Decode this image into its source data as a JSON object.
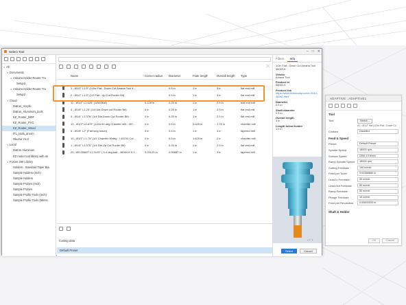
{
  "dialog": {
    "title": "Select Tool",
    "tabs": [
      "Filters",
      "Info"
    ],
    "buttons": {
      "select": "Select",
      "cancel": "Cancel"
    },
    "window_controls": [
      "–",
      "□",
      "✕"
    ]
  },
  "library_tree": [
    {
      "label": "All",
      "level": 0,
      "caret": "∨"
    },
    {
      "label": "Documents",
      "level": 1,
      "caret": "∨"
    },
    {
      "label": "Arduino Holder Router Tra",
      "level": 2,
      "caret": "∨"
    },
    {
      "label": "Setup3",
      "level": 3,
      "caret": ""
    },
    {
      "label": "Arduino Holder Router Tra",
      "level": 2,
      "caret": "∨"
    },
    {
      "label": "Setup2",
      "level": 3,
      "caret": ""
    },
    {
      "label": "Cloud",
      "level": 1,
      "caret": "∨"
    },
    {
      "label": "Datron_Acrylic",
      "level": 2,
      "caret": ""
    },
    {
      "label": "Datron_Aluminum_tools",
      "level": 2,
      "caret": ""
    },
    {
      "label": "EZ_Router_MDF",
      "level": 2,
      "caret": ""
    },
    {
      "label": "EZ_Router_PVC",
      "level": 2,
      "caret": ""
    },
    {
      "label": "EZ_Router_Wood",
      "level": 2,
      "caret": "",
      "selected": true
    },
    {
      "label": "IFL_tools_aroom",
      "level": 2,
      "caret": ""
    },
    {
      "label": "Okuma V1.3",
      "level": 2,
      "caret": ""
    },
    {
      "label": "Local",
      "level": 1,
      "caret": "∨"
    },
    {
      "label": "Datron Aluminum",
      "level": 2,
      "caret": ""
    },
    {
      "label": "EZ router tool library with an",
      "level": 2,
      "caret": ""
    },
    {
      "label": "Fusion 360 Library",
      "level": 1,
      "caret": "∨"
    },
    {
      "label": "Holders - Standard Taper Bla",
      "level": 2,
      "caret": ""
    },
    {
      "label": "Sample Holders (Inch)",
      "level": 2,
      "caret": ""
    },
    {
      "label": "Sample Holders",
      "level": 2,
      "caret": ""
    },
    {
      "label": "Sample Probes (Inch)",
      "level": 2,
      "caret": ""
    },
    {
      "label": "Sample Probes",
      "level": 2,
      "caret": ""
    },
    {
      "label": "Sample Profile Tools (Inch)",
      "level": 2,
      "caret": ""
    },
    {
      "label": "Sample Profile Tools (Metric",
      "level": 2,
      "caret": ""
    }
  ],
  "table": {
    "headers": [
      "Name",
      "Corner radius",
      "Diameter",
      "Flute length",
      "Overall length",
      "Type"
    ],
    "rows": [
      {
        "name": "1 - Ø1/2\" L1.5\" (1/2in Flat - Down Cut Amana Tool 4...",
        "corner": "",
        "diameter": "0.5 in",
        "flute": "1 in",
        "overall": "3 in",
        "type": "flat end mill",
        "selected": true
      },
      {
        "name": "2 - Ø1/2\" L1.5\" (1/2 Flat - Up Cut Router Bit)",
        "corner": "",
        "diameter": "0.5 in",
        "flute": "1 in",
        "overall": "3 in",
        "type": "flat end mill"
      },
      {
        "name": "11 - Ø1/4\" L1.625\" (1/8in Ball)",
        "corner": "0.125 in",
        "diameter": "0.25 in",
        "flute": "1 in",
        "overall": "2.5 in",
        "type": "ball end mill"
      },
      {
        "name": "4 - Ø1/8\" L1.25\" (1/4 Dia Down cut Router Bit)",
        "corner": "0 in",
        "diameter": "0.25 in",
        "flute": "1 in",
        "overall": "2.5 in",
        "type": "flat end mill"
      },
      {
        "name": "3 - Ø1/4\" L1.376\" (1/4 Dia Down Cut Router Bit)",
        "corner": "0 in",
        "diameter": "0.25 in",
        "flute": "1 in",
        "overall": "2.5 in",
        "type": "flat end mill"
      },
      {
        "name": "12 - Ø1/2\" L0.875\" (1/2in 60 deg Chamfer mill - 457...",
        "corner": "0 in",
        "diameter": "0.5 in",
        "flute": "0.625 in",
        "overall": "1.75 in",
        "type": "chamfer mill"
      },
      {
        "name": "5 - Ø1/8\" L2\" (Flat long reach)",
        "corner": "0 in",
        "diameter": "0.5 in",
        "flute": "1 in",
        "overall": "3 in",
        "type": "tapered mill"
      },
      {
        "name": "10 - Ø1/2\" L1.75\" (1/2 Chamfer 90deg - I 45704 Cor...",
        "corner": "0 in",
        "diameter": "0.5 in",
        "flute": "1.625 in",
        "overall": "2 in",
        "type": "chamfer mill"
      },
      {
        "name": "1 - Ø1/4\" L1.376\" (1/4 Dia Up Cut Router Bit)",
        "corner": "0 in",
        "diameter": "0.25 in",
        "flute": "1 in",
        "overall": "2.5 in",
        "type": "flat end mill"
      },
      {
        "name": "20 - Ø0.05669\" L2.3125\" ( 5.4 deg ball - 46084-K 0.1...",
        "corner": "0.03125 in",
        "diameter": "0.05687 in",
        "flute": "1 in",
        "overall": "3 in",
        "type": "tapered mill"
      }
    ]
  },
  "cutting_data": {
    "label": "Cutting data",
    "preset": "Default Preset"
  },
  "info": [
    {
      "key": "",
      "value": "1/2in Flat - Down Cut Amana Tool 46082-K"
    },
    {
      "key": "Vendor",
      "value": "Amana Tool"
    },
    {
      "key": "Product Id",
      "value": "46082-K"
    },
    {
      "key": "Product link",
      "value": "https://www.toolstoday.com/v-5010-46082.html",
      "link": true
    },
    {
      "key": "Diameter",
      "value": "0.5 in"
    },
    {
      "key": "Shaft diameter",
      "value": "0.5 in"
    },
    {
      "key": "Overall length",
      "value": "3 in"
    },
    {
      "key": "Length below holder",
      "value": "1.5 in"
    }
  ],
  "adaptive_panel": {
    "title": "ADAPTIVE : ADAPTIVE1",
    "tool_section": "Tool",
    "tool_label": "Tool",
    "tool_button": "Select...",
    "tool_desc": "#1 - Ø1/2\" flat (1/2in Flat - Down Cu",
    "coolant_label": "Coolant",
    "coolant_value": "Disabled",
    "feed_section": "Feed & Speed",
    "fields": [
      {
        "label": "Preset",
        "value": "Default Preset"
      },
      {
        "label": "Spindle Speed",
        "value": "18000 rpm"
      },
      {
        "label": "Surface Speed",
        "value": "2356.19 ft/min"
      },
      {
        "label": "Ramp Spindle Speed",
        "value": "18000 rpm"
      },
      {
        "label": "Cutting Feedrate",
        "value": "140 in/min"
      },
      {
        "label": "Feed per Tooth",
        "value": "0.00388889 in"
      },
      {
        "label": "Lead-In Feedrate",
        "value": "50 in/min"
      },
      {
        "label": "Lead-Out Feedrate",
        "value": "50 in/min"
      },
      {
        "label": "Ramp Feedrate",
        "value": "50 in/min"
      },
      {
        "label": "Plunge Feedrate",
        "value": "15 in/min"
      },
      {
        "label": "Feed per Revolution",
        "value": "0.00833333 in"
      }
    ],
    "shaft_section": "Shaft & Holder",
    "ok": "OK",
    "cancel": "Cancel"
  },
  "colors": {
    "accent": "#2d7bd1",
    "highlight_box": "#f0932b",
    "selection": "#cfe3f7"
  }
}
